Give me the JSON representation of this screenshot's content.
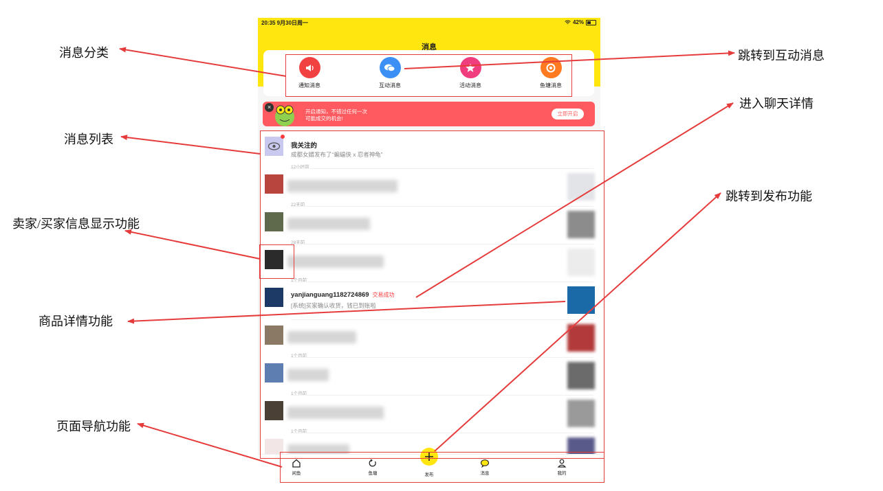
{
  "colors": {
    "brand_yellow": "#ffe60f",
    "accent_red": "#ff3b3b",
    "annotation_red": "#e63b3b"
  },
  "status_bar": {
    "time_date": "20:35  9月30日周一",
    "battery": "42%"
  },
  "header": {
    "title": "消息"
  },
  "categories": [
    {
      "label": "通知消息",
      "icon": "speaker-icon",
      "color": "#f24141"
    },
    {
      "label": "互动消息",
      "icon": "chat-bubbles-icon",
      "color": "#3b8ff5"
    },
    {
      "label": "活动消息",
      "icon": "star-icon",
      "color": "#f03d7d"
    },
    {
      "label": "鱼塘消息",
      "icon": "ring-dot-icon",
      "color": "#ff7a21"
    }
  ],
  "banner": {
    "line1": "开启通知，不错过任何一次",
    "line2": "可能成交的机会!",
    "button": "立即开启",
    "close": "×"
  },
  "messages": [
    {
      "name": "我关注的",
      "tag": "",
      "text": "成都女婿发布了“蝙蝠侠 x 忍者神龟”",
      "time": "12小时前",
      "avatar": "eye-icon",
      "avatar_color": "#c9c8ef",
      "unread": true,
      "blurred": false,
      "thumb": "",
      "thumb_color": ""
    },
    {
      "name": "",
      "tag": "",
      "text": "",
      "time": "22天前",
      "avatar": "photo-avatar-red-tower",
      "avatar_color": "#b8463f",
      "unread": false,
      "blurred": true,
      "thumb": "product-thumb-screenshot",
      "thumb_color": "#e2e4e8"
    },
    {
      "name": "",
      "tag": "",
      "text": "",
      "time": "28天前",
      "avatar": "photo-avatar-soldier",
      "avatar_color": "#5f6a4c",
      "unread": false,
      "blurred": true,
      "thumb": "product-thumb-grey",
      "thumb_color": "#8c8c8c"
    },
    {
      "name": "",
      "tag": "",
      "text": "",
      "time": "1个月前",
      "avatar": "photo-avatar-suit",
      "avatar_color": "#2b2b2b",
      "unread": false,
      "blurred": true,
      "thumb": "product-thumb-light",
      "thumb_color": "#ececec"
    },
    {
      "name": "yanjianguang1182724869",
      "tag": "交易成功",
      "text": "[系统]买家确认收货，钱已到账啦",
      "time": "",
      "avatar": "photo-avatar-blue-screen",
      "avatar_color": "#1d3a66",
      "unread": false,
      "blurred": false,
      "thumb": "product-thumb-book",
      "thumb_color": "#1a6aa8"
    },
    {
      "name": "",
      "tag": "",
      "text": "",
      "time": "1个月前",
      "avatar": "photo-avatar-man",
      "avatar_color": "#8a7a65",
      "unread": false,
      "blurred": true,
      "thumb": "product-thumb-red-box",
      "thumb_color": "#b23a3a"
    },
    {
      "name": "",
      "tag": "",
      "text": "",
      "time": "1个月前",
      "avatar": "cartoon-avatar-boy",
      "avatar_color": "#5e7db0",
      "unread": false,
      "blurred": true,
      "thumb": "product-thumb-grey-block",
      "thumb_color": "#6b6b6b"
    },
    {
      "name": "",
      "tag": "",
      "text": "",
      "time": "1个月前",
      "avatar": "photo-avatar-dark",
      "avatar_color": "#4a4036",
      "unread": false,
      "blurred": true,
      "thumb": "product-thumb-machine",
      "thumb_color": "#9a9a9a"
    },
    {
      "name": "",
      "tag": "",
      "text": "",
      "time": "",
      "avatar": "cartoon-avatar-rabbit",
      "avatar_color": "#f2e6e6",
      "unread": false,
      "blurred": true,
      "thumb": "product-thumb-purple",
      "thumb_color": "#5a5a8a"
    }
  ],
  "tab_bar": {
    "items": [
      {
        "label": "闲鱼",
        "icon": "home-icon"
      },
      {
        "label": "鱼塘",
        "icon": "refresh-circle-icon"
      },
      {
        "label": "消息",
        "icon": "speech-bubble-icon"
      },
      {
        "label": "我的",
        "icon": "person-icon"
      }
    ],
    "publish": {
      "label": "发布",
      "icon": "plus-icon"
    }
  },
  "annotations": {
    "category": "消息分类",
    "list": "消息列表",
    "seller_info": "卖家/买家信息显示功能",
    "product_detail": "商品详情功能",
    "navigation": "页面导航功能",
    "interactive": "跳转到互动消息",
    "chat_detail": "进入聊天详情",
    "publish": "跳转到发布功能"
  }
}
